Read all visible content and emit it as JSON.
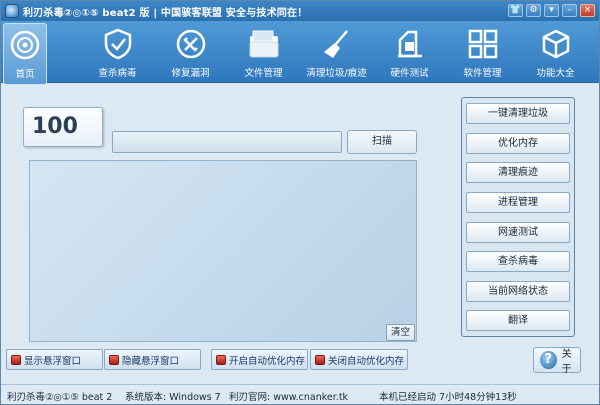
{
  "titlebar": {
    "title": "利刃杀毒②◎①⑤ beat2 版 | 中国骇客联盟 安全与技术同在！"
  },
  "toolbar": {
    "items": [
      {
        "label": "首页",
        "icon": "home-target-icon"
      },
      {
        "label": "查杀病毒",
        "icon": "shield-icon"
      },
      {
        "label": "修复漏洞",
        "icon": "repair-icon"
      },
      {
        "label": "文件管理",
        "icon": "folder-icon"
      },
      {
        "label": "清理垃圾/痕迹",
        "icon": "broom-icon"
      },
      {
        "label": "硬件测试",
        "icon": "hardware-icon"
      },
      {
        "label": "软件管理",
        "icon": "grid-icon"
      },
      {
        "label": "功能大全",
        "icon": "cube-icon"
      }
    ]
  },
  "main": {
    "score": "100",
    "scan_label": "扫描",
    "clear_label": "清空"
  },
  "side": {
    "buttons": [
      "一键清理垃圾",
      "优化内存",
      "清理痕迹",
      "进程管理",
      "网速测试",
      "查杀病毒",
      "当前网络状态",
      "翻译"
    ]
  },
  "bottom": {
    "buttons": [
      "显示悬浮窗口",
      "隐藏悬浮窗口",
      "开启自动优化内存",
      "关闭自动优化内存"
    ],
    "about_label": "关于"
  },
  "status": {
    "version": "利刃杀毒②◎①⑤ beat 2",
    "system": "系统版本: Windows 7",
    "website": "利刃官网: www.cnanker.tk",
    "uptime": "本机已经启动 7小时48分钟13秒"
  }
}
